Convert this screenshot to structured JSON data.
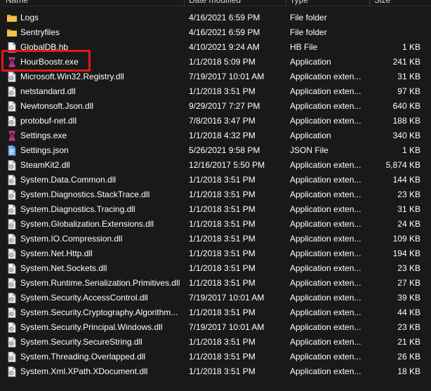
{
  "header": {
    "name": "Name",
    "date": "Date modified",
    "type": "Type",
    "size": "Size"
  },
  "colors": {
    "background": "#191919",
    "text": "#ffffff",
    "folder": "#f3c34c",
    "exe": "#c8328a",
    "highlight": "#e8141c"
  },
  "files": [
    {
      "icon": "folder-icon",
      "name": "Logs",
      "date": "4/16/2021 6:59 PM",
      "type": "File folder",
      "size": ""
    },
    {
      "icon": "folder-icon",
      "name": "Sentryfiles",
      "date": "4/16/2021 6:59 PM",
      "type": "File folder",
      "size": ""
    },
    {
      "icon": "file-icon",
      "name": "GlobalDB.hb",
      "date": "4/10/2021 9:24 AM",
      "type": "HB File",
      "size": "1 KB"
    },
    {
      "icon": "hourglass-icon",
      "name": "HourBoostr.exe",
      "date": "1/1/2018 5:09 PM",
      "type": "Application",
      "size": "241 KB"
    },
    {
      "icon": "dll-icon",
      "name": "Microsoft.Win32.Registry.dll",
      "date": "7/19/2017 10:01 AM",
      "type": "Application exten...",
      "size": "31 KB"
    },
    {
      "icon": "dll-icon",
      "name": "netstandard.dll",
      "date": "1/1/2018 3:51 PM",
      "type": "Application exten...",
      "size": "97 KB"
    },
    {
      "icon": "dll-icon",
      "name": "Newtonsoft.Json.dll",
      "date": "9/29/2017 7:27 PM",
      "type": "Application exten...",
      "size": "640 KB"
    },
    {
      "icon": "dll-icon",
      "name": "protobuf-net.dll",
      "date": "7/8/2016 3:47 PM",
      "type": "Application exten...",
      "size": "188 KB"
    },
    {
      "icon": "hourglass-icon",
      "name": "Settings.exe",
      "date": "1/1/2018 4:32 PM",
      "type": "Application",
      "size": "340 KB"
    },
    {
      "icon": "json-icon",
      "name": "Settings.json",
      "date": "5/26/2021 9:58 PM",
      "type": "JSON File",
      "size": "1 KB"
    },
    {
      "icon": "dll-icon",
      "name": "SteamKit2.dll",
      "date": "12/16/2017 5:50 PM",
      "type": "Application exten...",
      "size": "5,874 KB"
    },
    {
      "icon": "dll-icon",
      "name": "System.Data.Common.dll",
      "date": "1/1/2018 3:51 PM",
      "type": "Application exten...",
      "size": "144 KB"
    },
    {
      "icon": "dll-icon",
      "name": "System.Diagnostics.StackTrace.dll",
      "date": "1/1/2018 3:51 PM",
      "type": "Application exten...",
      "size": "23 KB"
    },
    {
      "icon": "dll-icon",
      "name": "System.Diagnostics.Tracing.dll",
      "date": "1/1/2018 3:51 PM",
      "type": "Application exten...",
      "size": "31 KB"
    },
    {
      "icon": "dll-icon",
      "name": "System.Globalization.Extensions.dll",
      "date": "1/1/2018 3:51 PM",
      "type": "Application exten...",
      "size": "24 KB"
    },
    {
      "icon": "dll-icon",
      "name": "System.IO.Compression.dll",
      "date": "1/1/2018 3:51 PM",
      "type": "Application exten...",
      "size": "109 KB"
    },
    {
      "icon": "dll-icon",
      "name": "System.Net.Http.dll",
      "date": "1/1/2018 3:51 PM",
      "type": "Application exten...",
      "size": "194 KB"
    },
    {
      "icon": "dll-icon",
      "name": "System.Net.Sockets.dll",
      "date": "1/1/2018 3:51 PM",
      "type": "Application exten...",
      "size": "23 KB"
    },
    {
      "icon": "dll-icon",
      "name": "System.Runtime.Serialization.Primitives.dll",
      "date": "1/1/2018 3:51 PM",
      "type": "Application exten...",
      "size": "27 KB"
    },
    {
      "icon": "dll-icon",
      "name": "System.Security.AccessControl.dll",
      "date": "7/19/2017 10:01 AM",
      "type": "Application exten...",
      "size": "39 KB"
    },
    {
      "icon": "dll-icon",
      "name": "System.Security.Cryptography.Algorithm...",
      "date": "1/1/2018 3:51 PM",
      "type": "Application exten...",
      "size": "44 KB"
    },
    {
      "icon": "dll-icon",
      "name": "System.Security.Principal.Windows.dll",
      "date": "7/19/2017 10:01 AM",
      "type": "Application exten...",
      "size": "23 KB"
    },
    {
      "icon": "dll-icon",
      "name": "System.Security.SecureString.dll",
      "date": "1/1/2018 3:51 PM",
      "type": "Application exten...",
      "size": "21 KB"
    },
    {
      "icon": "dll-icon",
      "name": "System.Threading.Overlapped.dll",
      "date": "1/1/2018 3:51 PM",
      "type": "Application exten...",
      "size": "26 KB"
    },
    {
      "icon": "dll-icon",
      "name": "System.Xml.XPath.XDocument.dll",
      "date": "1/1/2018 3:51 PM",
      "type": "Application exten...",
      "size": "18 KB"
    }
  ]
}
